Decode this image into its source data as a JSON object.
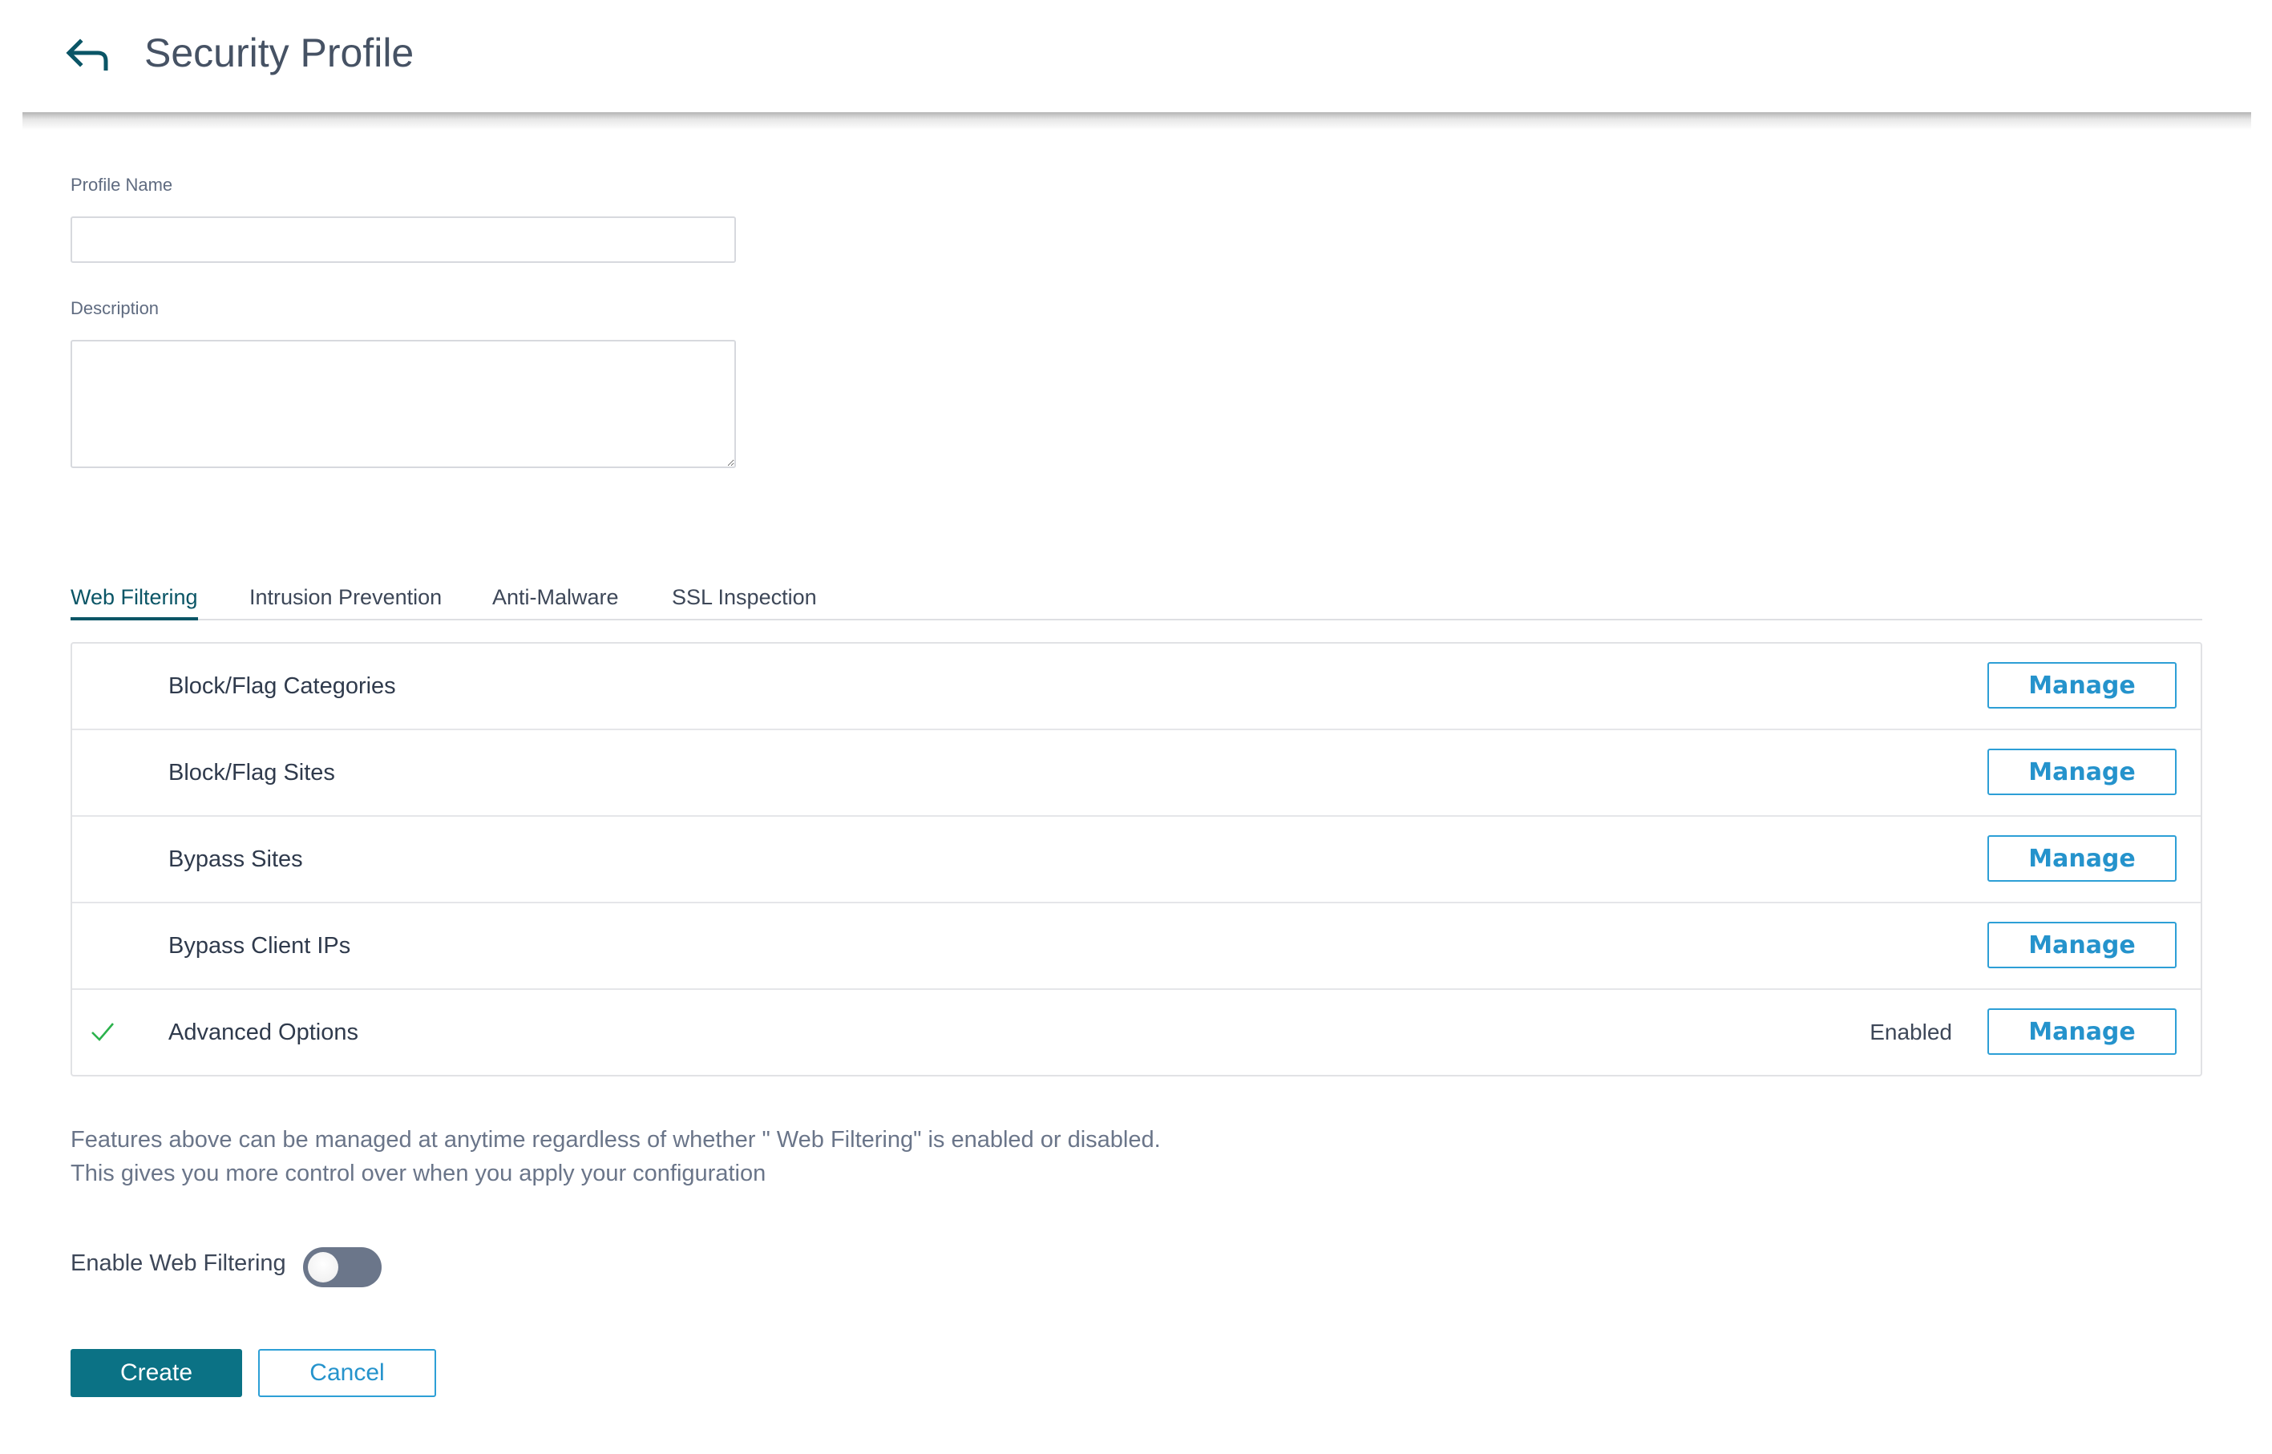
{
  "header": {
    "title": "Security Profile",
    "back_icon": "back-arrow-icon"
  },
  "form": {
    "profile_name": {
      "label": "Profile Name",
      "value": "",
      "placeholder": ""
    },
    "description": {
      "label": "Description",
      "value": "",
      "placeholder": ""
    }
  },
  "tabs": [
    {
      "label": "Web Filtering",
      "active": true
    },
    {
      "label": "Intrusion Prevention",
      "active": false
    },
    {
      "label": "Anti-Malware",
      "active": false
    },
    {
      "label": "SSL Inspection",
      "active": false
    }
  ],
  "features": [
    {
      "label": "Block/Flag Categories",
      "checked": false,
      "status": "",
      "action": "Manage"
    },
    {
      "label": "Block/Flag Sites",
      "checked": false,
      "status": "",
      "action": "Manage"
    },
    {
      "label": "Bypass Sites",
      "checked": false,
      "status": "",
      "action": "Manage"
    },
    {
      "label": "Bypass Client IPs",
      "checked": false,
      "status": "",
      "action": "Manage"
    },
    {
      "label": "Advanced Options",
      "checked": true,
      "status": "Enabled",
      "action": "Manage"
    }
  ],
  "notes": {
    "line1": "Features above can be managed at anytime regardless of whether \" Web Filtering\" is enabled or disabled.",
    "line2": "This gives you more control over when you apply your configuration"
  },
  "toggle": {
    "label": "Enable Web Filtering",
    "on": false
  },
  "actions": {
    "create": "Create",
    "cancel": "Cancel"
  },
  "colors": {
    "primary": "#0b7285",
    "accent": "#2593cc",
    "tab_active": "#0a5566",
    "check": "#2bb24c",
    "toggle_off": "#6b768a"
  }
}
